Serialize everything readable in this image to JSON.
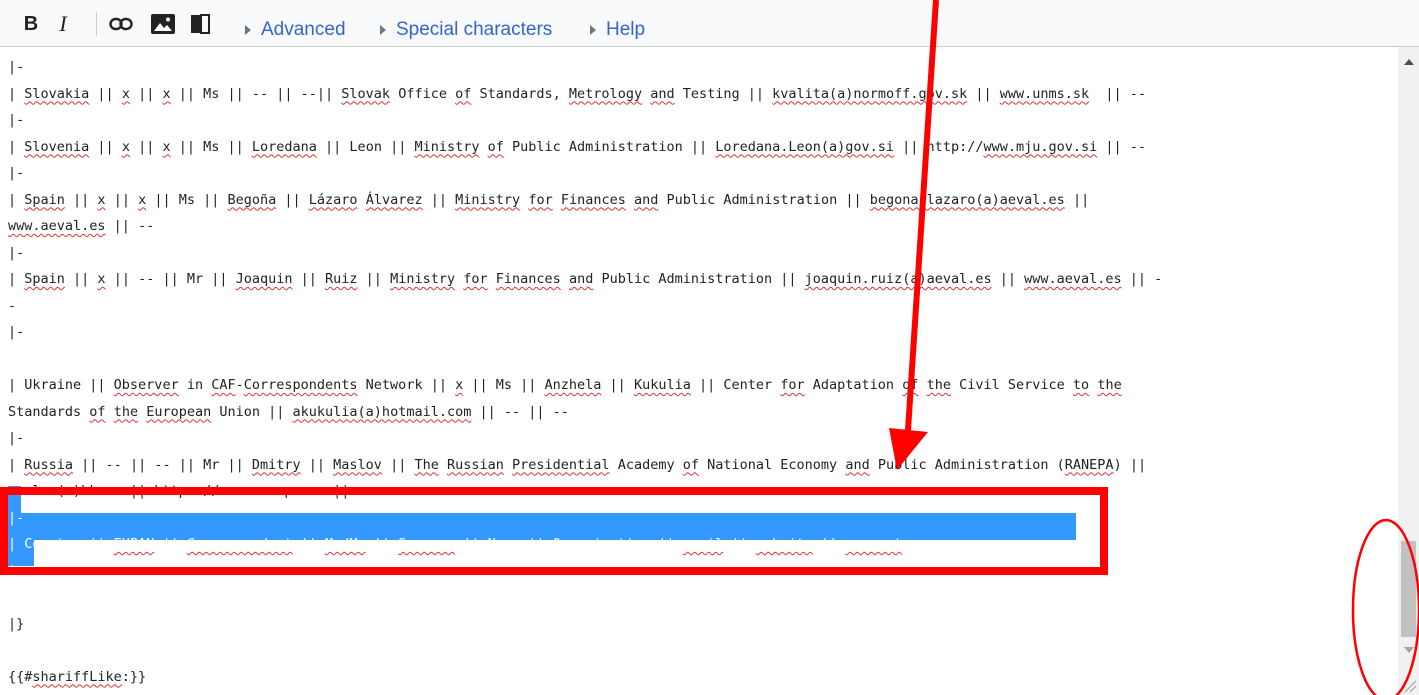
{
  "toolbar": {
    "bold_label": "B",
    "italic_label": "I",
    "link_icon": "link-icon",
    "image_icon": "image-icon",
    "reference_icon": "book-icon",
    "sections": [
      {
        "label": "Advanced"
      },
      {
        "label": "Special characters"
      },
      {
        "label": "Help"
      }
    ],
    "link_color": "#3366cc"
  },
  "editor": {
    "lines": [
      [
        {
          "t": "|-"
        }
      ],
      [
        {
          "t": "| "
        },
        {
          "t": "Slovakia",
          "sq": true
        },
        {
          "t": " || "
        },
        {
          "t": "x",
          "sq": true
        },
        {
          "t": " || "
        },
        {
          "t": "x",
          "sq": true
        },
        {
          "t": " || Ms || -- || --|| "
        },
        {
          "t": "Slovak",
          "sq": true
        },
        {
          "t": " Office "
        },
        {
          "t": "of",
          "sq": true
        },
        {
          "t": " Standards, "
        },
        {
          "t": "Metrology",
          "sq": true
        },
        {
          "t": " "
        },
        {
          "t": "and",
          "sq": true
        },
        {
          "t": " Testing || "
        },
        {
          "t": "kvalita(a)normoff.gov.sk",
          "sq": true
        },
        {
          "t": " || "
        },
        {
          "t": "www.unms.sk",
          "sq": true
        },
        {
          "t": "  || --"
        }
      ],
      [
        {
          "t": "|-"
        }
      ],
      [
        {
          "t": "| "
        },
        {
          "t": "Slovenia",
          "sq": true
        },
        {
          "t": " || "
        },
        {
          "t": "x",
          "sq": true
        },
        {
          "t": " || "
        },
        {
          "t": "x",
          "sq": true
        },
        {
          "t": " || Ms || "
        },
        {
          "t": "Loredana",
          "sq": true
        },
        {
          "t": " || Leon || "
        },
        {
          "t": "Ministry",
          "sq": true
        },
        {
          "t": " "
        },
        {
          "t": "of",
          "sq": true
        },
        {
          "t": " Public Administration || "
        },
        {
          "t": "Loredana.Leon(a)gov.si",
          "sq": true
        },
        {
          "t": " || http://"
        },
        {
          "t": "www.mju.gov.si",
          "sq": true
        },
        {
          "t": " || --"
        }
      ],
      [
        {
          "t": "|-"
        }
      ],
      [
        {
          "t": "| "
        },
        {
          "t": "Spain",
          "sq": true
        },
        {
          "t": " || "
        },
        {
          "t": "x",
          "sq": true
        },
        {
          "t": " || "
        },
        {
          "t": "x",
          "sq": true
        },
        {
          "t": " || Ms || "
        },
        {
          "t": "Begoña",
          "sq": true
        },
        {
          "t": " || "
        },
        {
          "t": "Lázaro",
          "sq": true
        },
        {
          "t": " "
        },
        {
          "t": "Álvarez",
          "sq": true
        },
        {
          "t": " || "
        },
        {
          "t": "Ministry",
          "sq": true
        },
        {
          "t": " "
        },
        {
          "t": "for",
          "sq": true
        },
        {
          "t": " "
        },
        {
          "t": "Finances",
          "sq": true
        },
        {
          "t": " "
        },
        {
          "t": "and",
          "sq": true
        },
        {
          "t": " Public Administration || "
        },
        {
          "t": "begona.lazaro(a)aeval.es",
          "sq": true
        },
        {
          "t": " ||"
        }
      ],
      [
        {
          "t": "www.aeval.es",
          "sq": true
        },
        {
          "t": " || --"
        }
      ],
      [
        {
          "t": "|-"
        }
      ],
      [
        {
          "t": "| "
        },
        {
          "t": "Spain",
          "sq": true
        },
        {
          "t": " || "
        },
        {
          "t": "x",
          "sq": true
        },
        {
          "t": " || -- || Mr || "
        },
        {
          "t": "Joaquin",
          "sq": true
        },
        {
          "t": " || "
        },
        {
          "t": "Ruiz",
          "sq": true
        },
        {
          "t": " || "
        },
        {
          "t": "Ministry",
          "sq": true
        },
        {
          "t": " "
        },
        {
          "t": "for",
          "sq": true
        },
        {
          "t": " "
        },
        {
          "t": "Finances",
          "sq": true
        },
        {
          "t": " "
        },
        {
          "t": "and",
          "sq": true
        },
        {
          "t": " Public Administration || "
        },
        {
          "t": "joaquin.ruiz(a)aeval.es",
          "sq": true
        },
        {
          "t": " || "
        },
        {
          "t": "www.aeval.es",
          "sq": true
        },
        {
          "t": " || -"
        }
      ],
      [
        {
          "t": "-"
        }
      ],
      [
        {
          "t": "|-"
        }
      ],
      [
        {
          "t": ""
        }
      ],
      [
        {
          "t": "| Ukraine || "
        },
        {
          "t": "Observer",
          "sq": true
        },
        {
          "t": " in "
        },
        {
          "t": "CAF",
          "sq": true
        },
        {
          "t": "-"
        },
        {
          "t": "Correspondents",
          "sq": true
        },
        {
          "t": " Network || "
        },
        {
          "t": "x",
          "sq": true
        },
        {
          "t": " || Ms || "
        },
        {
          "t": "Anzhela",
          "sq": true
        },
        {
          "t": " || "
        },
        {
          "t": "Kukulia",
          "sq": true
        },
        {
          "t": " || Center "
        },
        {
          "t": "for",
          "sq": true
        },
        {
          "t": " Adaptation "
        },
        {
          "t": "of",
          "sq": true
        },
        {
          "t": " "
        },
        {
          "t": "the",
          "sq": true
        },
        {
          "t": " Civil Service "
        },
        {
          "t": "to",
          "sq": true
        },
        {
          "t": " "
        },
        {
          "t": "the",
          "sq": true
        }
      ],
      [
        {
          "t": "Standards "
        },
        {
          "t": "of",
          "sq": true
        },
        {
          "t": " "
        },
        {
          "t": "the",
          "sq": true
        },
        {
          "t": " "
        },
        {
          "t": "European",
          "sq": true
        },
        {
          "t": " Union || "
        },
        {
          "t": "akukulia(a)hotmail.com",
          "sq": true
        },
        {
          "t": " || -- || --"
        }
      ],
      [
        {
          "t": "|-"
        }
      ],
      [
        {
          "t": "| "
        },
        {
          "t": "Russia",
          "sq": true
        },
        {
          "t": " || -- || -- || Mr || "
        },
        {
          "t": "Dmitry",
          "sq": true
        },
        {
          "t": " || "
        },
        {
          "t": "Maslov",
          "sq": true
        },
        {
          "t": " || "
        },
        {
          "t": "The",
          "sq": true
        },
        {
          "t": " "
        },
        {
          "t": "Russian",
          "sq": true
        },
        {
          "t": " "
        },
        {
          "t": "Presidential",
          "sq": true
        },
        {
          "t": " Academy "
        },
        {
          "t": "of",
          "sq": true
        },
        {
          "t": " National Economy "
        },
        {
          "t": "and",
          "sq": true
        },
        {
          "t": " Public Administration ("
        },
        {
          "t": "RANEPA",
          "sq": true
        },
        {
          "t": ") ||"
        }
      ],
      [
        {
          "t": "maslow(a)bk.ru || https://www.ranepa.ru || --"
        }
      ],
      [
        {
          "t": "|-",
          "sel": true
        }
      ],
      [
        {
          "t": "| Country || ",
          "sel": true
        },
        {
          "t": "EUPAN",
          "sq": true,
          "sel": true
        },
        {
          "t": " || ",
          "sel": true
        },
        {
          "t": "Correspondent",
          "sq": true,
          "sel": true
        },
        {
          "t": " || ",
          "sel": true
        },
        {
          "t": "Mr/Ms",
          "sq": true,
          "sel": true
        },
        {
          "t": " || ",
          "sel": true
        },
        {
          "t": "Surname",
          "sq": true,
          "sel": true
        },
        {
          "t": " || Name || Organisation || ",
          "sel": true
        },
        {
          "t": "email",
          "sq": true,
          "sel": true
        },
        {
          "t": " || ",
          "sel": true
        },
        {
          "t": "website",
          "sq": true,
          "sel": true
        },
        {
          "t": " || ",
          "sel": true
        },
        {
          "t": "comment",
          "sq": true,
          "sel": true
        }
      ],
      [
        {
          "t": "|-",
          "sel": true
        }
      ],
      [
        {
          "t": ""
        }
      ],
      [
        {
          "t": "|}"
        }
      ],
      [
        {
          "t": ""
        }
      ],
      [
        {
          "t": "{{#"
        },
        {
          "t": "shariffLike",
          "sq": true
        },
        {
          "t": ":}}"
        }
      ]
    ],
    "selection_color": "#3399ff",
    "spellcheck_color": "#dd3333"
  },
  "annotations": {
    "color": "#ff0000"
  },
  "scrollbar": {
    "up_icon": "scroll-up-arrow-icon",
    "down_icon": "scroll-down-arrow-icon",
    "resize_icon": "resize-grip-icon"
  }
}
